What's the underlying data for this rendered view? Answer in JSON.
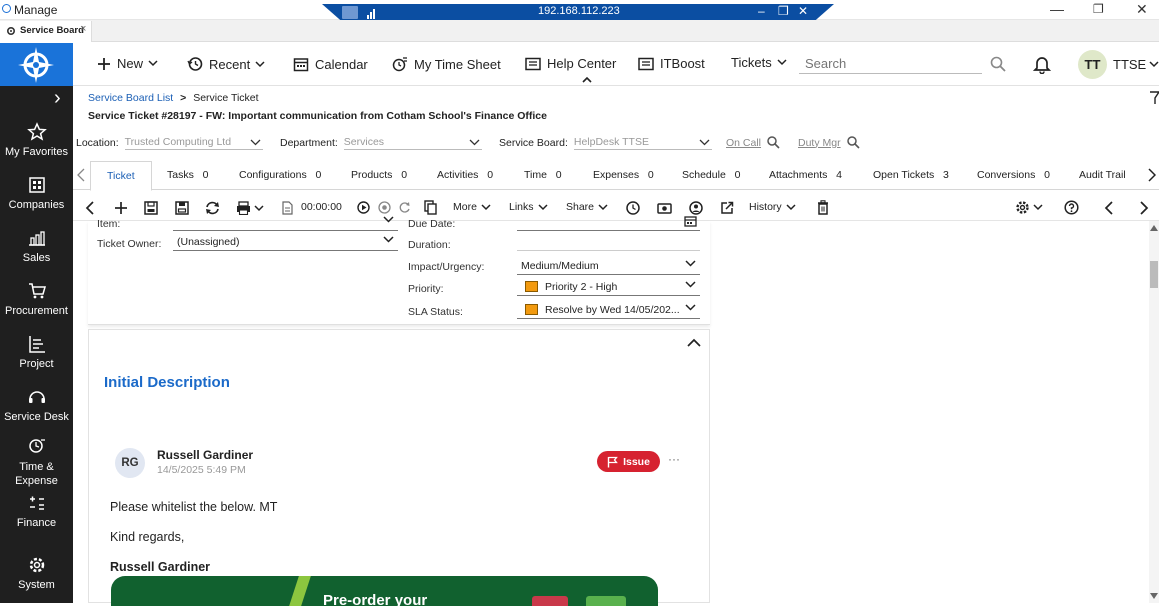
{
  "window": {
    "app_title": "Manage",
    "rdp_ip": "192.168.112.223",
    "rdp_minimize": "–",
    "rdp_restore": "❐",
    "rdp_close": "✕",
    "min": "—",
    "restore": "❐",
    "close": "✕"
  },
  "browser_tab": {
    "label": "Service Board",
    "close": "×"
  },
  "nav": {
    "expand": "›",
    "items": [
      {
        "label": "My Favorites",
        "icon": "star-icon"
      },
      {
        "label": "Companies",
        "icon": "building-icon"
      },
      {
        "label": "Sales",
        "icon": "chart-icon"
      },
      {
        "label": "Procurement",
        "icon": "cart-icon"
      },
      {
        "label": "Project",
        "icon": "list-icon"
      },
      {
        "label": "Service Desk",
        "icon": "headset-icon"
      },
      {
        "label": "Time &",
        "label2": "Expense",
        "icon": "clock-icon"
      },
      {
        "label": "Finance",
        "icon": "calc-icon"
      },
      {
        "label": "System",
        "icon": "gear-icon"
      }
    ]
  },
  "header": {
    "new": "New",
    "recent": "Recent",
    "calendar": "Calendar",
    "timesheet": "My Time Sheet",
    "help": "Help Center",
    "itboost": "ITBoost",
    "tickets": "Tickets",
    "search_placeholder": "Search",
    "avatar_initials": "TT",
    "user": "TTSE"
  },
  "breadcrumb": {
    "list": "Service Board List",
    "sep": ">",
    "current": "Service Ticket"
  },
  "ticket_title": "Service Ticket #28197 - FW: Important communication from Cotham School's Finance Office",
  "location_row": {
    "location_label": "Location:",
    "location_value": "Trusted Computing Ltd",
    "department_label": "Department:",
    "department_value": "Services",
    "board_label": "Service Board:",
    "board_value": "HelpDesk TTSE",
    "on_call": "On Call",
    "duty_mgr": "Duty Mgr"
  },
  "tabs": [
    {
      "label": "Ticket",
      "count": ""
    },
    {
      "label": "Tasks",
      "count": "0"
    },
    {
      "label": "Configurations",
      "count": "0"
    },
    {
      "label": "Products",
      "count": "0"
    },
    {
      "label": "Activities",
      "count": "0"
    },
    {
      "label": "Time",
      "count": "0"
    },
    {
      "label": "Expenses",
      "count": "0"
    },
    {
      "label": "Schedule",
      "count": "0"
    },
    {
      "label": "Attachments",
      "count": "4"
    },
    {
      "label": "Open Tickets",
      "count": "3"
    },
    {
      "label": "Conversions",
      "count": "0"
    },
    {
      "label": "Audit Trail",
      "count": ""
    }
  ],
  "toolbar": {
    "timer": "00:00:00",
    "more": "More",
    "links": "Links",
    "share": "Share",
    "history": "History"
  },
  "details": {
    "item_label": "Item:",
    "owner_label": "Ticket Owner:",
    "owner_value": "(Unassigned)",
    "due_label": "Due Date:",
    "duration_label": "Duration:",
    "impact_label": "Impact/Urgency:",
    "impact_value": "Medium/Medium",
    "priority_label": "Priority:",
    "priority_value": "Priority 2 - High",
    "sla_label": "SLA Status:",
    "sla_value": "Resolve by Wed 14/05/202...",
    "swatch_color": "#f29a0f"
  },
  "description": {
    "heading": "Initial Description",
    "initials": "RG",
    "author": "Russell Gardiner",
    "timestamp": "14/5/2025 5:49 PM",
    "badge": "Issue",
    "more": "···",
    "line1": "Please whitelist the below. MT",
    "line2": "Kind regards,",
    "signature": "Russell Gardiner",
    "banner_text": "Pre-order your"
  }
}
